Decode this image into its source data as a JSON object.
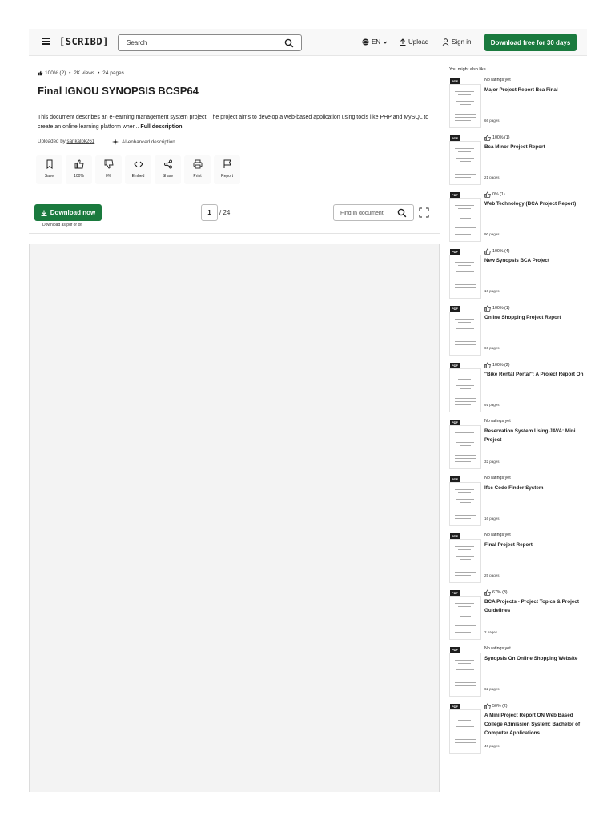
{
  "header": {
    "logo": "[SCRIBD]",
    "search_placeholder": "Search",
    "language": "EN",
    "upload": "Upload",
    "signin": "Sign in",
    "cta": "Download free for 30 days"
  },
  "doc": {
    "meta_rating": "100% (2)",
    "meta_views": "2K views",
    "meta_pages": "24 pages",
    "title": "Final IGNOU SYNOPSIS BCSP64",
    "description": "This document describes an e-learning management system project. The project aims to develop a web-based application using tools like PHP and MySQL to create an online learning platform wher...",
    "full_description": "Full description",
    "uploaded_by_label": "Uploaded by",
    "uploader": "sankalpk261",
    "ai_label": "AI-enhanced description"
  },
  "actions": [
    {
      "label": "Save",
      "icon": "bookmark-icon"
    },
    {
      "label": "100%",
      "icon": "thumbs-up-icon"
    },
    {
      "label": "0%",
      "icon": "thumbs-down-icon"
    },
    {
      "label": "Embed",
      "icon": "code-icon"
    },
    {
      "label": "Share",
      "icon": "share-icon"
    },
    {
      "label": "Print",
      "icon": "print-icon"
    },
    {
      "label": "Report",
      "icon": "flag-icon"
    }
  ],
  "download": {
    "label": "Download now",
    "sub": "Download as pdf or txt"
  },
  "pager": {
    "current": "1",
    "total": "/ 24",
    "find_placeholder": "Find in document"
  },
  "sidebar": {
    "title": "You might also like",
    "items": [
      {
        "rating": "No ratings yet",
        "liked": false,
        "title": "Major Project Report Bca Final",
        "pages": "66 pages"
      },
      {
        "rating": "100% (1)",
        "liked": true,
        "title": "Bca Minor Project Report",
        "pages": "21 pages"
      },
      {
        "rating": "0% (1)",
        "liked": true,
        "title": "Web Technology (BCA Project Report)",
        "pages": "90 pages"
      },
      {
        "rating": "100% (4)",
        "liked": true,
        "title": "New Synopsis BCA Project",
        "pages": "16 pages"
      },
      {
        "rating": "100% (1)",
        "liked": true,
        "title": "Online Shopping Project Report",
        "pages": "66 pages"
      },
      {
        "rating": "100% (2)",
        "liked": true,
        "title": "\"Bike Rental Portal\": A Project Report On",
        "pages": "91 pages"
      },
      {
        "rating": "No ratings yet",
        "liked": false,
        "title": "Reservation System Using JAVA: Mini Project",
        "pages": "32 pages"
      },
      {
        "rating": "No ratings yet",
        "liked": false,
        "title": "Ifsc Code Finder System",
        "pages": "16 pages"
      },
      {
        "rating": "No ratings yet",
        "liked": false,
        "title": "Final Project Report",
        "pages": "25 pages"
      },
      {
        "rating": "67% (3)",
        "liked": true,
        "title": "BCA Projects - Project Topics & Project Guidelines",
        "pages": "2 pages"
      },
      {
        "rating": "No ratings yet",
        "liked": false,
        "title": "Synopsis On Online Shopping Website",
        "pages": "62 pages"
      },
      {
        "rating": "50% (2)",
        "liked": true,
        "title": "A Mini Project Report ON Web Based College Admission System: Bachelor of Computer Applications",
        "pages": "46 pages"
      }
    ]
  },
  "colors": {
    "brand_green": "#1a7a3e",
    "text": "#1e1e1e"
  }
}
